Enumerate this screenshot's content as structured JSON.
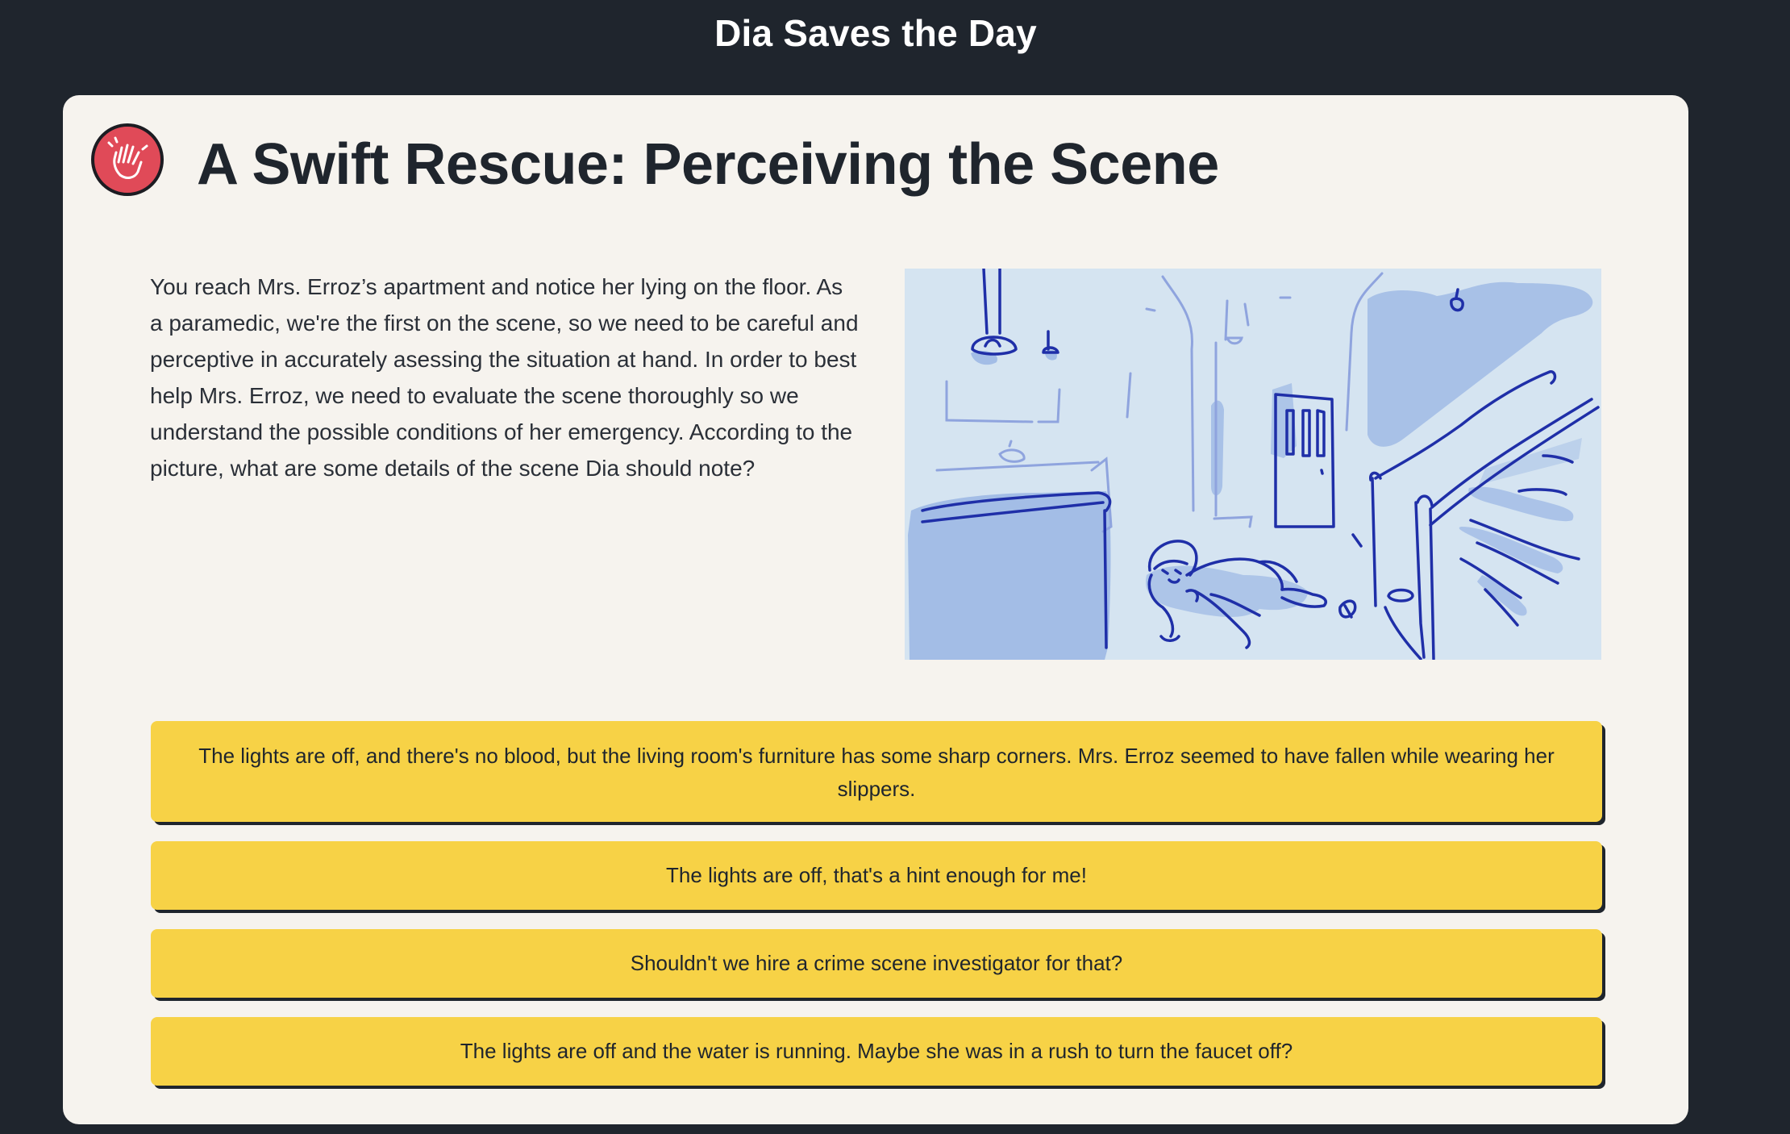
{
  "app": {
    "title": "Dia Saves the Day"
  },
  "question": {
    "icon": "waving-hand-icon",
    "heading": "A Swift Rescue: Perceiving the Scene",
    "prompt": "You reach Mrs. Erroz’s apartment and notice her lying on the floor. As a paramedic, we're the first on the scene, so we need to be careful and perceptive in accurately asessing the situation at hand. In order to best help Mrs. Erroz, we need to evaluate the scene thoroughly so we understand the possible conditions of her emergency. According to the picture, what are some details of the scene Dia should note?"
  },
  "answers": [
    "The lights are off, and there's no blood, but the living room's furniture has some sharp corners. Mrs. Erroz seemed to have fallen while wearing her slippers.",
    "The lights are off, that's a hint enough for me!",
    "Shouldn't we hire a crime scene investigator for that?",
    "The lights are off and the water is running. Maybe she was in a rush to turn the faucet off?"
  ],
  "colors": {
    "background": "#1f252d",
    "card": "#f6f3ee",
    "answer": "#f7d246",
    "badge": "#e04a58",
    "illustration_bg": "#d5e4f1",
    "illustration_fill": "#a3bde6",
    "illustration_line": "#1f2fa8"
  }
}
